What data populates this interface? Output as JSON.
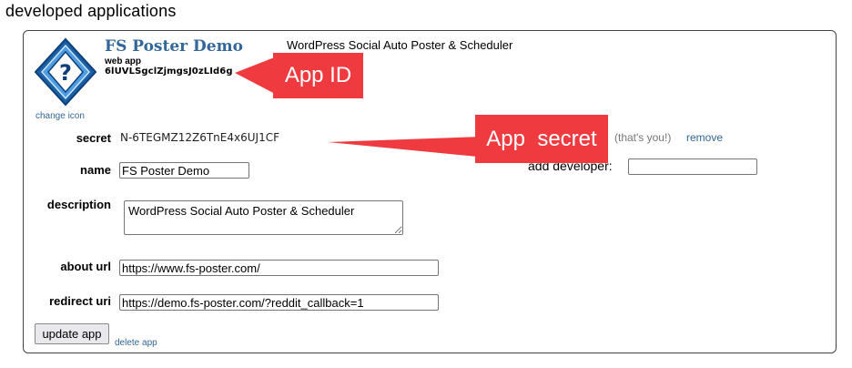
{
  "heading": "developed applications",
  "app": {
    "name": "FS Poster Demo",
    "type": "web app",
    "id": "6lUVLSgclZjmgsJ0zLId6g",
    "tagline": "WordPress Social Auto Poster & Scheduler",
    "change_icon_label": "change icon",
    "icon": "question-mark-icon"
  },
  "callouts": {
    "app_id": "App ID",
    "app_secret": "App  secret",
    "color": "#ef3b3f"
  },
  "form": {
    "secret_label": "secret",
    "secret_value": "N-6TEGMZ12Z6TnE4x6UJ1CF",
    "name_label": "name",
    "name_value": "FS Poster Demo",
    "description_label": "description",
    "description_value": "WordPress Social Auto Poster & Scheduler",
    "about_url_label": "about url",
    "about_url_value": "https://www.fs-poster.com/",
    "redirect_uri_label": "redirect uri",
    "redirect_uri_value": "https://demo.fs-poster.com/?reddit_callback=1"
  },
  "developers": {
    "you_note": "(that's you!)",
    "remove_label": "remove",
    "add_label": "add developer:",
    "add_value": ""
  },
  "actions": {
    "update_label": "update app",
    "delete_label": "delete app"
  },
  "colors": {
    "link": "#336699",
    "icon_blue": "#2f7fc7"
  }
}
